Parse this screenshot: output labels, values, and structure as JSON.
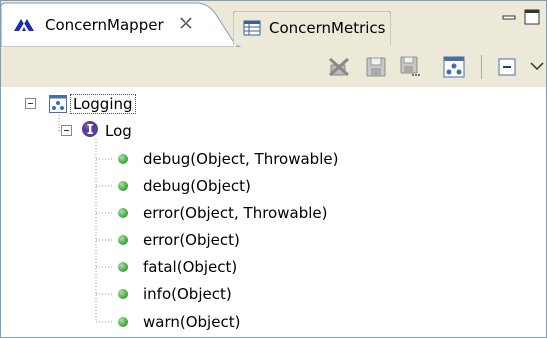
{
  "tabs": [
    {
      "label": "ConcernMapper",
      "icon": "concern-mapper-icon",
      "active": true,
      "closable": true
    },
    {
      "label": "ConcernMetrics",
      "icon": "table-icon",
      "active": false
    }
  ],
  "window_controls": [
    "minimize-icon",
    "maximize-icon"
  ],
  "toolbar": {
    "buttons": [
      {
        "name": "remove-icon"
      },
      {
        "name": "save-icon"
      },
      {
        "name": "save-as-icon"
      },
      {
        "name": "concern-model-icon"
      },
      {
        "name": "collapse-all-icon"
      },
      {
        "name": "view-menu-icon"
      }
    ]
  },
  "tree": {
    "root": {
      "label": "Logging",
      "icon": "concern-icon",
      "expanded": true
    },
    "interface": {
      "label": "Log",
      "icon": "interface-icon",
      "expanded": true
    },
    "methods": [
      {
        "label": "debug(Object, Throwable)",
        "icon": "public-method-icon"
      },
      {
        "label": "debug(Object)",
        "icon": "public-method-icon"
      },
      {
        "label": "error(Object, Throwable)",
        "icon": "public-method-icon"
      },
      {
        "label": "error(Object)",
        "icon": "public-method-icon"
      },
      {
        "label": "fatal(Object)",
        "icon": "public-method-icon"
      },
      {
        "label": "info(Object)",
        "icon": "public-method-icon"
      },
      {
        "label": "warn(Object)",
        "icon": "public-method-icon"
      }
    ]
  },
  "colors": {
    "chrome": "#ece9d8",
    "border": "#7f9db9",
    "method_green": "#4caf50",
    "interface_purple": "#5b3c9c"
  }
}
